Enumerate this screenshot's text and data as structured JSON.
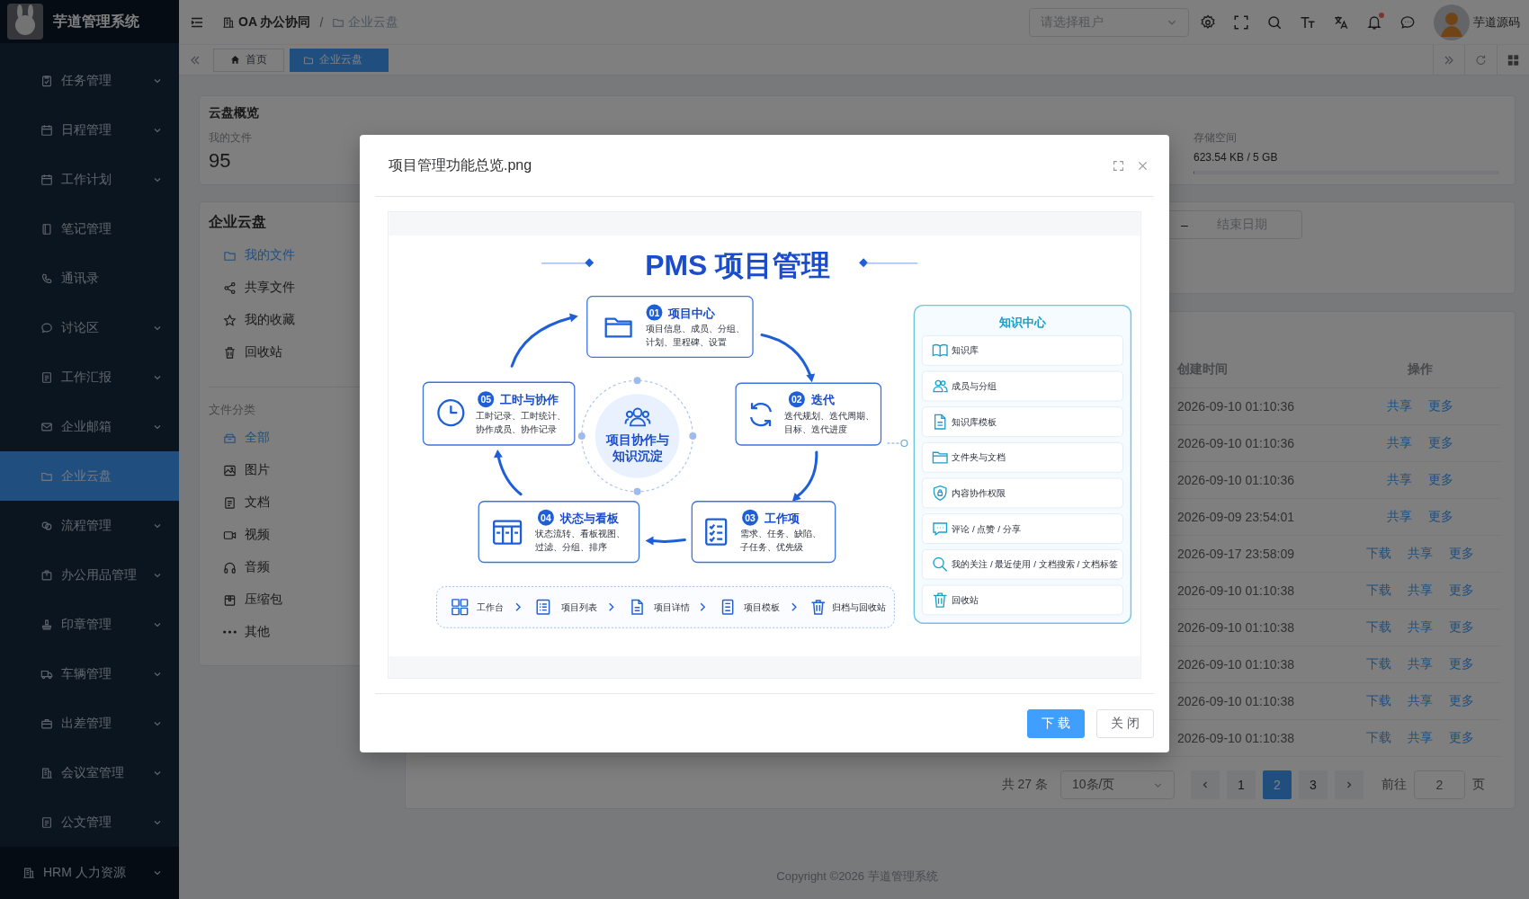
{
  "app": {
    "name": "芋道管理系统"
  },
  "sidebar": {
    "items": [
      {
        "label": "任务管理",
        "selected": false,
        "has_submenu": true
      },
      {
        "label": "日程管理",
        "selected": false,
        "has_submenu": true
      },
      {
        "label": "工作计划",
        "selected": false,
        "has_submenu": true
      },
      {
        "label": "笔记管理",
        "selected": false,
        "has_submenu": false
      },
      {
        "label": "通讯录",
        "selected": false,
        "has_submenu": false
      },
      {
        "label": "讨论区",
        "selected": false,
        "has_submenu": true
      },
      {
        "label": "工作汇报",
        "selected": false,
        "has_submenu": true
      },
      {
        "label": "企业邮箱",
        "selected": false,
        "has_submenu": true
      },
      {
        "label": "企业云盘",
        "selected": true,
        "has_submenu": false
      },
      {
        "label": "流程管理",
        "selected": false,
        "has_submenu": true
      },
      {
        "label": "办公用品管理",
        "selected": false,
        "has_submenu": true
      },
      {
        "label": "印章管理",
        "selected": false,
        "has_submenu": true
      },
      {
        "label": "车辆管理",
        "selected": false,
        "has_submenu": true
      },
      {
        "label": "出差管理",
        "selected": false,
        "has_submenu": true
      },
      {
        "label": "会议室管理",
        "selected": false,
        "has_submenu": true
      },
      {
        "label": "公文管理",
        "selected": false,
        "has_submenu": true
      }
    ],
    "footer": {
      "label": "HRM 人力资源",
      "has_submenu": true
    }
  },
  "header": {
    "breadcrumb": [
      "OA 办公协同",
      "企业云盘"
    ],
    "breadcrumb_separator": "/",
    "tenant_select": {
      "placeholder": "请选择租户"
    },
    "unread": true,
    "user": {
      "name": "芋道源码"
    }
  },
  "tabs": [
    {
      "label": "首页",
      "selected": false
    },
    {
      "label": "企业云盘",
      "selected": true
    }
  ],
  "overview": {
    "title": "云盘概览",
    "my_files": {
      "label": "我的文件",
      "value": "95"
    },
    "storage": {
      "label": "存储空间",
      "value": "623.54 KB / 5 GB",
      "level": 0.001
    }
  },
  "drive_panel": {
    "title": "企业云盘",
    "items": [
      {
        "label": "我的文件",
        "selected": true
      },
      {
        "label": "共享文件",
        "selected": false
      },
      {
        "label": "我的收藏",
        "selected": false
      },
      {
        "label": "回收站",
        "selected": false
      }
    ],
    "category_title": "文件分类",
    "categories": [
      {
        "label": "全部",
        "selected": true
      },
      {
        "label": "图片",
        "selected": false
      },
      {
        "label": "文档",
        "selected": false
      },
      {
        "label": "视频",
        "selected": false
      },
      {
        "label": "音频",
        "selected": false
      },
      {
        "label": "压缩包",
        "selected": false
      },
      {
        "label": "其他",
        "selected": false
      }
    ]
  },
  "filter": {
    "separator": "–",
    "end_date": {
      "placeholder": "结束日期"
    }
  },
  "table": {
    "columns": [
      "创建时间",
      "操作"
    ],
    "rows": [
      {
        "created": "2026-09-10 01:10:36",
        "actions": [
          "共享",
          "更多"
        ]
      },
      {
        "created": "2026-09-10 01:10:36",
        "actions": [
          "共享",
          "更多"
        ]
      },
      {
        "created": "2026-09-10 01:10:36",
        "actions": [
          "共享",
          "更多"
        ]
      },
      {
        "created": "2026-09-09 23:54:01",
        "actions": [
          "共享",
          "更多"
        ]
      },
      {
        "created": "2026-09-17 23:58:09",
        "actions": [
          "下载",
          "共享",
          "更多"
        ]
      },
      {
        "created": "2026-09-10 01:10:38",
        "actions": [
          "下载",
          "共享",
          "更多"
        ]
      },
      {
        "created": "2026-09-10 01:10:38",
        "actions": [
          "下载",
          "共享",
          "更多"
        ]
      },
      {
        "created": "2026-09-10 01:10:38",
        "actions": [
          "下载",
          "共享",
          "更多"
        ]
      },
      {
        "created": "2026-09-10 01:10:38",
        "actions": [
          "下载",
          "共享",
          "更多"
        ]
      },
      {
        "created": "2026-09-10 01:10:38",
        "actions": [
          "下载",
          "共享",
          "更多"
        ]
      }
    ]
  },
  "pagination": {
    "total": "共 27 条",
    "page_size": "10条/页",
    "pages": [
      {
        "label": "1",
        "selected": false
      },
      {
        "label": "2",
        "selected": true
      },
      {
        "label": "3",
        "selected": false
      }
    ],
    "goto_label": "前往",
    "goto_value": "2",
    "page_suffix": "页"
  },
  "footer": {
    "copyright": "Copyright ©2026 芋道管理系统"
  },
  "dialog": {
    "title": "项目管理功能总览.png",
    "diagram": {
      "title": "PMS 项目管理",
      "hub": [
        "项目协作与",
        "知识沉淀"
      ],
      "steps": [
        {
          "number": "01",
          "title": "项目中心",
          "lines": [
            "项目信息、成员、分组、",
            "计划、里程碑、设置"
          ]
        },
        {
          "number": "05",
          "title": "工时与协作",
          "lines": [
            "工时记录、工时统计、",
            "协作成员、协作记录"
          ]
        },
        {
          "number": "02",
          "title": "迭代",
          "lines": [
            "迭代规划、迭代周期、",
            "目标、迭代进度"
          ]
        },
        {
          "number": "04",
          "title": "状态与看板",
          "lines": [
            "状态流转、看板视图、",
            "过滤、分组、排序"
          ]
        },
        {
          "number": "03",
          "title": "工作项",
          "lines": [
            "需求、任务、缺陷、",
            "子任务、优先级"
          ]
        }
      ],
      "flow": [
        "工作台",
        "项目列表",
        "项目详情",
        "项目模板",
        "归档与回收站"
      ],
      "knowledge": {
        "title": "知识中心",
        "items": [
          "知识库",
          "成员与分组",
          "知识库模板",
          "文件夹与文档",
          "内容协作权限",
          "评论 / 点赞 / 分享",
          "我的关注 / 最近使用 / 文档搜索 / 文档标签",
          "回收站"
        ]
      }
    },
    "buttons": [
      {
        "label": "下 载",
        "kind": "primary"
      },
      {
        "label": "关 闭",
        "kind": "default"
      }
    ]
  }
}
